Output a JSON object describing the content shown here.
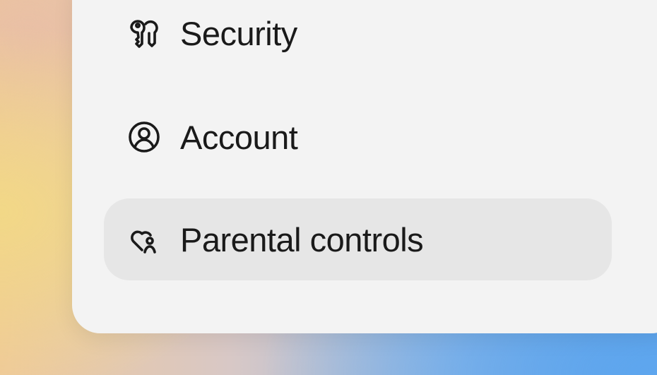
{
  "settings_menu": {
    "items": [
      {
        "label": "Security",
        "icon": "key-icon",
        "selected": false
      },
      {
        "label": "Account",
        "icon": "user-circle-icon",
        "selected": false
      },
      {
        "label": "Parental controls",
        "icon": "heart-person-icon",
        "selected": true
      }
    ]
  }
}
